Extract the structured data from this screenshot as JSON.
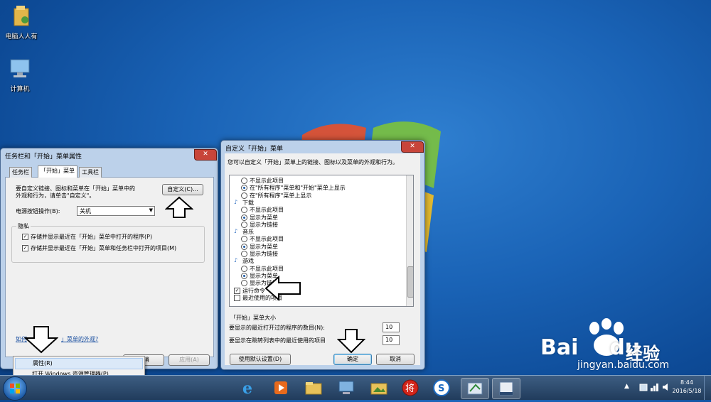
{
  "desktop": {
    "icons": [
      {
        "label": "电脑人人有",
        "icon": "folder-user-icon"
      },
      {
        "label": "计算机",
        "icon": "computer-icon"
      }
    ]
  },
  "taskbar_props_window": {
    "title": "任务栏和「开始」菜单属性",
    "close_label": "✕",
    "tabs": [
      {
        "label": "任务栏",
        "active": false
      },
      {
        "label": "「开始」菜单",
        "active": true
      },
      {
        "label": "工具栏",
        "active": false
      }
    ],
    "description_line1": "要自定义链接、图标和菜单在「开始」菜单中的",
    "description_line2": "外观和行为，请单击\"自定义\"。",
    "customize_button": "自定义(C)...",
    "power_label": "电源按钮操作(B):",
    "power_value": "关机",
    "privacy_group": "隐私",
    "privacy_1": "存储并显示最近在「开始」菜单中打开的程序(P)",
    "privacy_2": "存储并显示最近在「开始」菜单和任务栏中打开的项目(M)",
    "link_prefix": "如何",
    "link_suffix": "」菜单的外观?",
    "cancel_button": "取消",
    "apply_button": "应用(A)"
  },
  "context_menu": {
    "items": [
      {
        "label": "属性(R)",
        "highlight": true
      },
      {
        "label": "打开 Windows 资源管理器(P)",
        "highlight": false
      }
    ]
  },
  "customize_window": {
    "title": "自定义「开始」菜单",
    "close_label": "✕",
    "intro": "您可以自定义「开始」菜单上的链接、图标以及菜单的外观和行为。",
    "list": {
      "top_opts": [
        {
          "label": "不显示此项目",
          "on": false
        },
        {
          "label": "在\"所有程序\"菜单和\"开始\"菜单上显示",
          "on": true
        },
        {
          "label": "在\"所有程序\"菜单上显示",
          "on": false
        }
      ],
      "groups": [
        {
          "name": "下载",
          "icon": "download-icon",
          "opts": [
            {
              "label": "不显示此项目",
              "on": false
            },
            {
              "label": "显示为菜单",
              "on": true
            },
            {
              "label": "显示为链接",
              "on": false
            }
          ]
        },
        {
          "name": "音乐",
          "icon": "music-icon",
          "opts": [
            {
              "label": "不显示此项目",
              "on": false
            },
            {
              "label": "显示为菜单",
              "on": true
            },
            {
              "label": "显示为链接",
              "on": false
            }
          ]
        },
        {
          "name": "游戏",
          "icon": "games-icon",
          "opts": [
            {
              "label": "不显示此项目",
              "on": false
            },
            {
              "label": "显示为菜单",
              "on": true
            },
            {
              "label": "显示为链接",
              "on": false
            }
          ]
        }
      ],
      "run_command": "运行命令",
      "recent_items": "最近使用的项目"
    },
    "size_group": "「开始」菜单大小",
    "recent_programs_label": "要显示的最近打开过的程序的数目(N):",
    "recent_programs_value": "10",
    "jump_list_label": "要显示在跳转列表中的最近使用的项目",
    "jump_list_value": "10",
    "defaults_button": "使用默认设置(D)",
    "ok_button": "确定",
    "cancel_button": "取消"
  },
  "taskbar": {
    "time": "8:44",
    "date": "2016/5/18"
  },
  "watermark": {
    "brand": "Bai",
    "brand_suffix": "du",
    "cn": "经验",
    "url": "jingyan.baidu.com"
  }
}
